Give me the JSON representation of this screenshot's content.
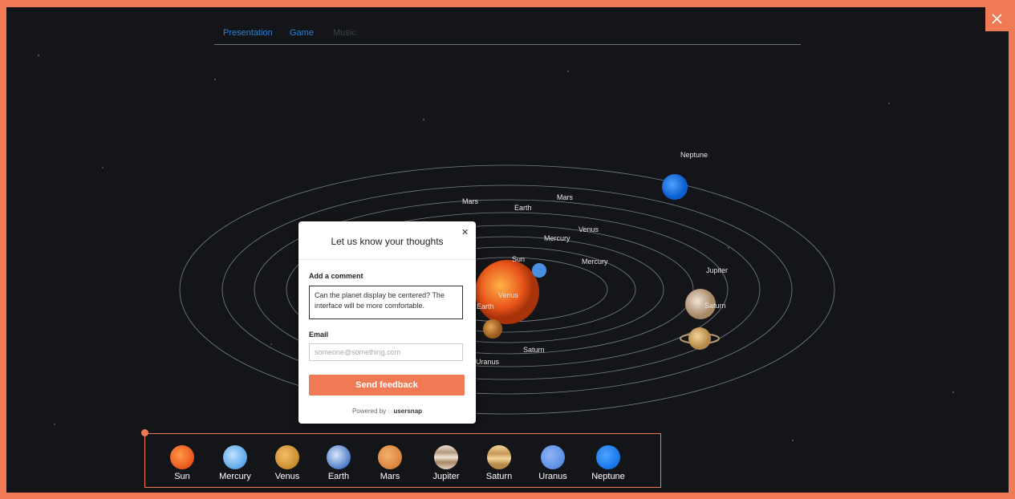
{
  "nav": {
    "tabs": [
      {
        "label": "Presentation",
        "color": "#2b7fd4"
      },
      {
        "label": "Game",
        "color": "#2b7fd4"
      },
      {
        "label": "Music",
        "color": "#3b3f48"
      }
    ]
  },
  "orbit_labels": [
    "Neptune",
    "Mars",
    "Earth",
    "Mars",
    "Venus",
    "Mercury",
    "Sun",
    "Mercury",
    "Jupiter",
    "Venus",
    "Earth",
    "Saturn",
    "Saturn",
    "Uranus"
  ],
  "feedback": {
    "title": "Let us know your thoughts",
    "close_icon": "close-icon",
    "comment_label": "Add a comment",
    "comment_value": "Can the planet display be centered?  The interface will be more comfortable.",
    "email_label": "Email",
    "email_placeholder": "someone@something.com",
    "send_label": "Send feedback",
    "powered_prefix": "Powered by",
    "powered_brand": "usersnap"
  },
  "dock": {
    "planets": [
      {
        "label": "Sun",
        "color": "#e8541a"
      },
      {
        "label": "Mercury",
        "color": "#5aa5e8"
      },
      {
        "label": "Venus",
        "color": "#c98a2c"
      },
      {
        "label": "Earth",
        "color": "#4d7cc7"
      },
      {
        "label": "Mars",
        "color": "#d9843b"
      },
      {
        "label": "Jupiter",
        "color": "#cfb9a0"
      },
      {
        "label": "Saturn",
        "color": "#d9b27a"
      },
      {
        "label": "Uranus",
        "color": "#5b8de6"
      },
      {
        "label": "Neptune",
        "color": "#1575e8"
      }
    ]
  },
  "colors": {
    "accent": "#f07a55",
    "background": "#141518"
  }
}
